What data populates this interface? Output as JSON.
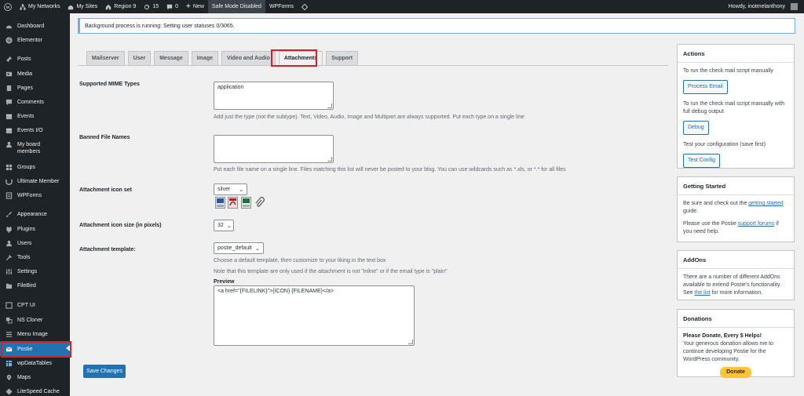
{
  "adminbar": {
    "my_networks": "My Networks",
    "my_sites": "My Sites",
    "region": "Region 9",
    "updates_count": "15",
    "comments_count": "0",
    "new": "New",
    "safe_mode": "Safe Mode Disabled",
    "wpforms": "WPForms",
    "howdy": "Howdy, inotmelanthony"
  },
  "sidebar": {
    "items": [
      {
        "label": "Dashboard",
        "icon": "dashboard-icon"
      },
      {
        "label": "Elementor",
        "icon": "elementor-icon"
      },
      {
        "label": "Posts",
        "icon": "pin-icon"
      },
      {
        "label": "Media",
        "icon": "media-icon"
      },
      {
        "label": "Pages",
        "icon": "page-icon"
      },
      {
        "label": "Comments",
        "icon": "comment-icon"
      },
      {
        "label": "Events",
        "icon": "calendar-icon"
      },
      {
        "label": "Events I/O",
        "icon": "calendar-icon"
      },
      {
        "label": "My board members",
        "icon": "user-icon"
      },
      {
        "label": "Groups",
        "icon": "groups-icon"
      },
      {
        "label": "Ultimate Member",
        "icon": "um-icon"
      },
      {
        "label": "WPForms",
        "icon": "form-icon"
      },
      {
        "label": "Appearance",
        "icon": "brush-icon"
      },
      {
        "label": "Plugins",
        "icon": "plugin-icon"
      },
      {
        "label": "Users",
        "icon": "user-icon"
      },
      {
        "label": "Tools",
        "icon": "wrench-icon"
      },
      {
        "label": "Settings",
        "icon": "settings-icon"
      },
      {
        "label": "FileBird",
        "icon": "folder-icon"
      },
      {
        "label": "CPT UI",
        "icon": "cpt-icon"
      },
      {
        "label": "NS Cloner",
        "icon": "cloner-icon"
      },
      {
        "label": "Menu Image",
        "icon": "menu-icon"
      },
      {
        "label": "Postie",
        "icon": "email-icon"
      },
      {
        "label": "wpDataTables",
        "icon": "table-icon"
      },
      {
        "label": "Maps",
        "icon": "map-pin-icon"
      },
      {
        "label": "LiteSpeed Cache",
        "icon": "litespeed-icon"
      }
    ]
  },
  "notice": "Background process is running: Setting user statuses 0/3065.",
  "tabs": [
    "Mailserver",
    "User",
    "Message",
    "Image",
    "Video and Audio",
    "Attachments",
    "Support"
  ],
  "form": {
    "mime_label": "Supported MIME Types",
    "mime_value": "application",
    "mime_desc": "Add just the type (not the subtype). Text, Video, Audio, Image and Multipart are always supported. Put each type on a single line",
    "banned_label": "Banned File Names",
    "banned_value": "",
    "banned_desc": "Put each file name on a single line. Files matching this list will never be posted to your blog. You can use wildcards such as *.xls, or *.* for all files",
    "iconset_label": "Attachment icon set",
    "iconset_value": "silver",
    "iconsize_label": "Attachment icon size (in pixels)",
    "iconsize_value": "32",
    "template_label": "Attachment template:",
    "template_value": "postie_default",
    "template_desc1": "Choose a default template, then customize to your liking in the text box",
    "template_desc2": "Note that this template are only used if the attachment is not \"inline\" or if the email type is \"plain\"",
    "preview_label": "Preview",
    "preview_value": "<a href=\"{FILELINK}\">{ICON} {FILENAME}</a>",
    "save": "Save Changes"
  },
  "actions": {
    "title": "Actions",
    "text1": "To run the check mail script manually",
    "btn1": "Process Email",
    "text2": "To run the check mail script manually with full debug output",
    "btn2": "Debug",
    "text3": "Test your configuration (save first)",
    "btn3": "Test Config"
  },
  "getting_started": {
    "title": "Getting Started",
    "p1a": "Be sure and check out the ",
    "p1link": "getting started",
    "p1b": " guide.",
    "p2a": "Please use the Postie ",
    "p2link": "support forums",
    "p2b": " if you need help."
  },
  "addons": {
    "title": "AddOns",
    "p1": "There are a number of different AddOns available to extend Postie's functionality. See ",
    "link": "the list",
    "p2": " for more information."
  },
  "donations": {
    "title": "Donations",
    "heading": "Please Donate, Every $ Helps!",
    "text": "Your generous donation allows me to continue developing Postie for the WordPress community.",
    "btn": "Donate"
  }
}
